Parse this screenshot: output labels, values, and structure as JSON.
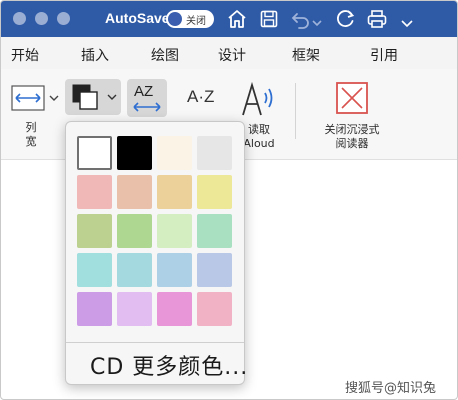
{
  "title_bar": {
    "autosave_label": "AutoSave",
    "toggle_text": "关闭"
  },
  "tabs": [
    {
      "label": "开始"
    },
    {
      "label": "插入"
    },
    {
      "label": "绘图"
    },
    {
      "label": "设计"
    },
    {
      "label": "框架"
    },
    {
      "label": "引用"
    }
  ],
  "ribbon": {
    "column_width_label": "列",
    "column_width_label2": "宽",
    "read_aloud_label": "读取",
    "read_aloud_label2": "Aloud",
    "close_reader_label": "关闭沉浸式",
    "close_reader_label2": "阅读器",
    "az_label": "AZ",
    "a_z_label": "A·Z"
  },
  "page_color_menu": {
    "swatches": [
      "#ffffff",
      "#000000",
      "#faf3e6",
      "#e6e6e6",
      "#f1b8b8",
      "#e9c0aa",
      "#ecd29a",
      "#ede898",
      "#bcd08f",
      "#aed892",
      "#d4eec2",
      "#a9e0c1",
      "#a1dede",
      "#a5d9e0",
      "#add0e6",
      "#b9c8e6",
      "#cc9ce6",
      "#e1bdf2",
      "#e996d8",
      "#f2b2c6"
    ],
    "more_colors_label": "CD 更多颜色..."
  },
  "watermark": "搜狐号@知识兔",
  "colors": {
    "title_bar": "#2f5aa6",
    "accent_red": "#d9534f"
  }
}
